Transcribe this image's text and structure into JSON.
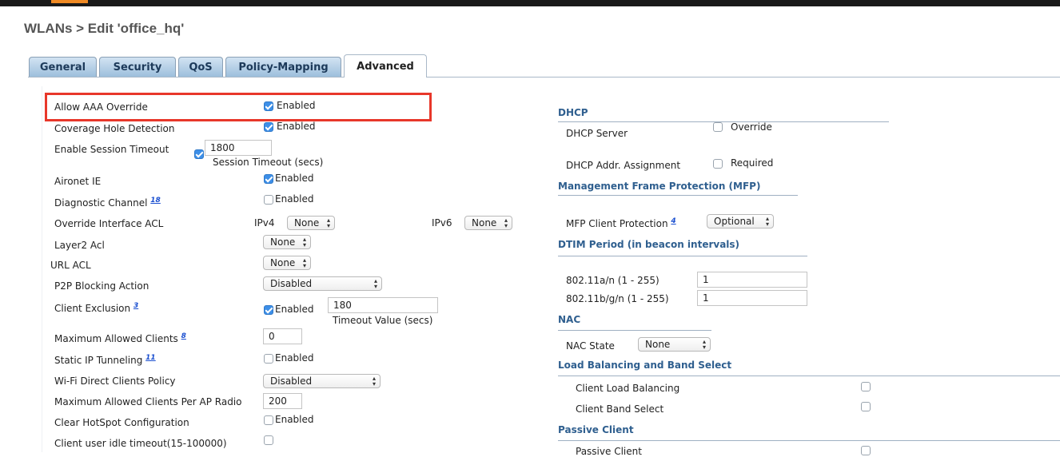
{
  "header": {
    "title": "WLANs > Edit  'office_hq'"
  },
  "tabs": [
    {
      "label": "General"
    },
    {
      "label": "Security"
    },
    {
      "label": "QoS"
    },
    {
      "label": "Policy-Mapping"
    },
    {
      "label": "Advanced"
    }
  ],
  "active_tab": "Advanced",
  "left": {
    "allow_aaa_override": {
      "label": "Allow AAA Override",
      "checked": true,
      "text": "Enabled"
    },
    "coverage_hole": {
      "label": "Coverage Hole Detection",
      "checked": true,
      "text": "Enabled"
    },
    "session_timeout": {
      "label": "Enable Session Timeout",
      "checked": true,
      "value": "1800",
      "caption": "Session Timeout (secs)"
    },
    "aironet_ie": {
      "label": "Aironet IE",
      "checked": true,
      "text": "Enabled"
    },
    "diagnostic_channel": {
      "label": "Diagnostic Channel",
      "footnote": "18",
      "checked": false,
      "text": "Enabled"
    },
    "override_acl": {
      "label": "Override Interface ACL",
      "ipv4_label": "IPv4",
      "ipv4_value": "None",
      "ipv6_label": "IPv6",
      "ipv6_value": "None"
    },
    "layer2_acl": {
      "label": "Layer2 Acl",
      "value": "None"
    },
    "url_acl": {
      "label": "URL ACL",
      "value": "None"
    },
    "p2p_blocking": {
      "label": "P2P Blocking Action",
      "value": "Disabled"
    },
    "client_exclusion": {
      "label": "Client Exclusion",
      "footnote": "3",
      "checked": true,
      "text": "Enabled",
      "value": "180",
      "caption": "Timeout Value (secs)"
    },
    "max_clients": {
      "label": "Maximum Allowed Clients",
      "footnote": "8",
      "value": "0"
    },
    "static_ip_tunneling": {
      "label": "Static IP Tunneling",
      "footnote": "11",
      "checked": false,
      "text": "Enabled"
    },
    "wifi_direct": {
      "label": "Wi-Fi Direct Clients Policy",
      "value": "Disabled"
    },
    "max_clients_per_radio": {
      "label": "Maximum Allowed Clients Per AP Radio",
      "value": "200"
    },
    "clear_hotspot": {
      "label": "Clear HotSpot Configuration",
      "checked": false,
      "text": "Enabled"
    },
    "idle_timeout": {
      "label": "Client user idle timeout(15-100000)",
      "checked": false
    }
  },
  "right": {
    "dhcp": {
      "title": "DHCP",
      "server": {
        "label": "DHCP Server",
        "checked": false,
        "text": "Override"
      },
      "addr_assignment": {
        "label": "DHCP Addr. Assignment",
        "checked": false,
        "text": "Required"
      }
    },
    "mfp": {
      "title": "Management Frame Protection (MFP)",
      "client_protection": {
        "label": "MFP Client Protection",
        "footnote": "4",
        "value": "Optional"
      }
    },
    "dtim": {
      "title": "DTIM Period (in beacon intervals)",
      "an": {
        "label": "802.11a/n (1 - 255)",
        "value": "1"
      },
      "bgn": {
        "label": "802.11b/g/n (1 - 255)",
        "value": "1"
      }
    },
    "nac": {
      "title": "NAC",
      "state": {
        "label": "NAC State",
        "value": "None"
      }
    },
    "load_balancing": {
      "title": "Load Balancing and Band Select",
      "client_load_balancing": {
        "label": "Client Load Balancing",
        "checked": false
      },
      "client_band_select": {
        "label": "Client Band Select",
        "checked": false
      }
    },
    "passive": {
      "title": "Passive Client",
      "passive_client": {
        "label": "Passive Client",
        "checked": false
      }
    }
  },
  "colors": {
    "highlight": "#e8372a",
    "section_title": "#2f5f8f",
    "checkbox_on": "#3d8fe8"
  }
}
